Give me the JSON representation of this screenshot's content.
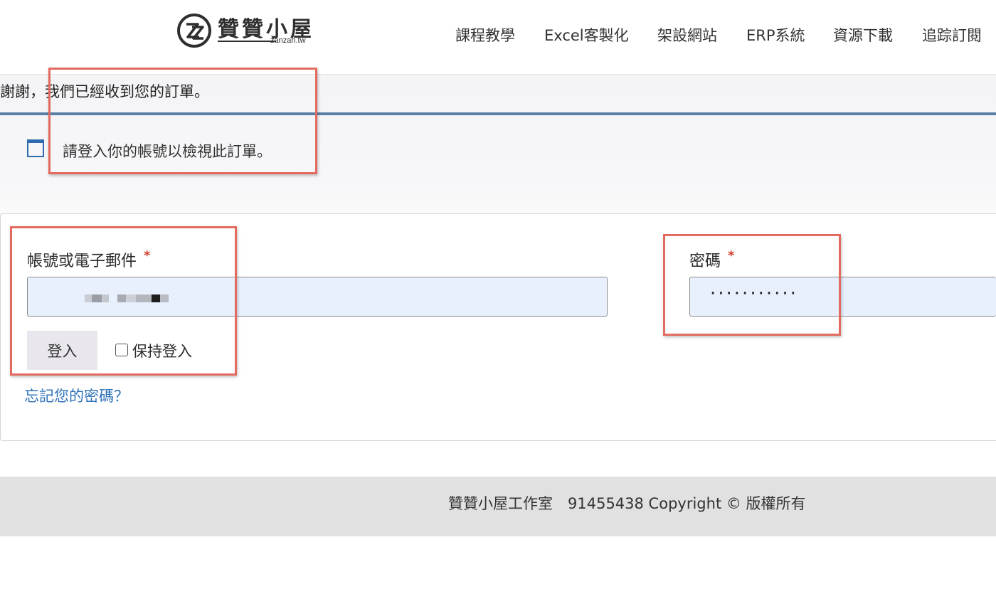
{
  "header": {
    "logo": {
      "mark": "ZZ",
      "name": "贊贊小屋",
      "subtitle": "zanzan.tw"
    },
    "nav": [
      "課程教學",
      "Excel客製化",
      "架設網站",
      "ERP系統",
      "資源下載",
      "追踪訂閱"
    ]
  },
  "order_notice": {
    "thanks": "謝謝，我們已經收到您的訂單。",
    "info_icon": "window-icon",
    "info_message": "請登入你的帳號以檢視此訂單。"
  },
  "login": {
    "username_label": "帳號或電子郵件",
    "password_label": "密碼",
    "required_mark": "*",
    "password_value": "···········",
    "login_button": "登入",
    "remember_label": "保持登入",
    "remember_checked": false,
    "forgot_link": "忘記您的密碼？"
  },
  "footer": {
    "text": "贊贊小屋工作室　91455438 Copyright © 版權所有"
  },
  "colors": {
    "accent_bar": "#5a7fa4",
    "link": "#2f73b8",
    "required": "#d23b2b",
    "annotation": "#e36a5f",
    "input_bg": "#e8f0fe"
  }
}
